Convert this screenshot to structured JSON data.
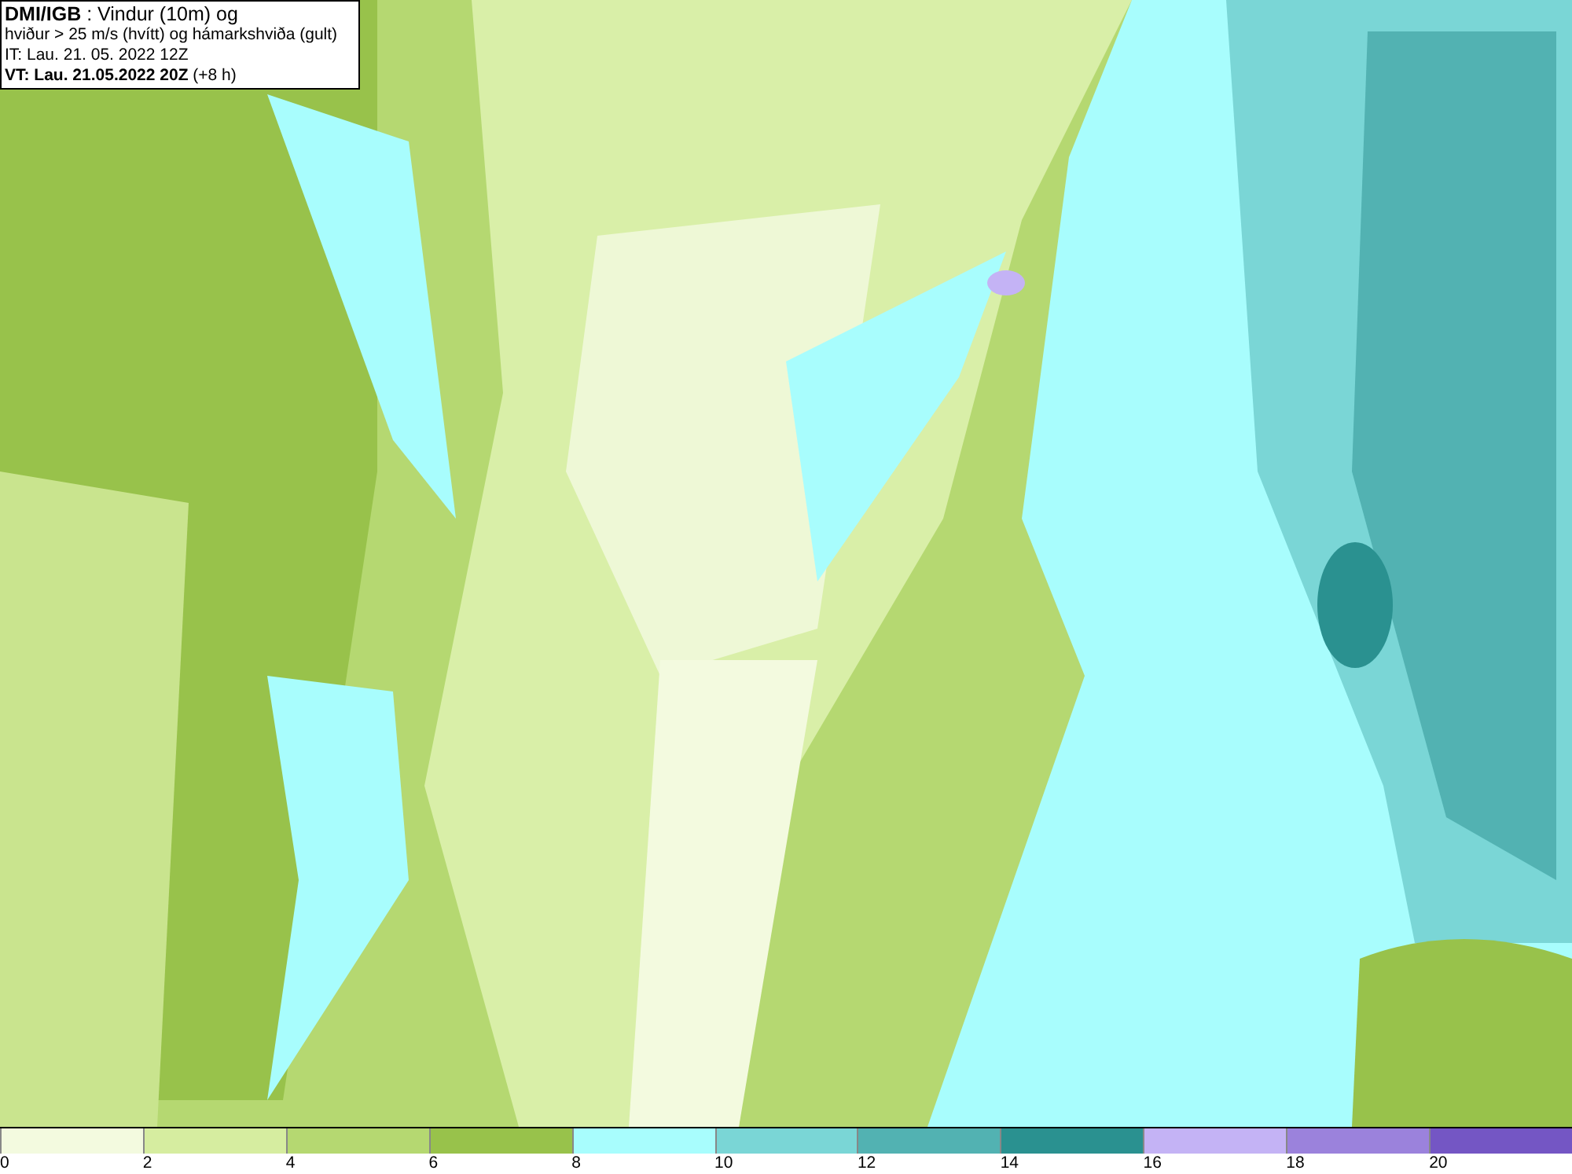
{
  "info_box": {
    "lines": [
      "**DMI/IGB** : Vindur (10m) og",
      "hviður > 25 m/s (hvítt) og hámarkshviða (gult)",
      "IT: Lau. 21. 05. 2022 12Z",
      "**VT: Lau. 21.05.2022 20Z** (+8 h)"
    ]
  },
  "legend": {
    "segments": [
      {
        "color": "#f3fadf",
        "label": "0"
      },
      {
        "color": "#d6eda0",
        "label": "2"
      },
      {
        "color": "#b5d871",
        "label": "4"
      },
      {
        "color": "#98c24b",
        "label": "6"
      },
      {
        "color": "#a8fdfd",
        "label": "8"
      },
      {
        "color": "#7ad6d6",
        "label": "10"
      },
      {
        "color": "#52b2b2",
        "label": "12"
      },
      {
        "color": "#2a9190",
        "label": "14"
      },
      {
        "color": "#c4b3f5",
        "label": "16"
      },
      {
        "color": "#9b82dc",
        "label": "18"
      },
      {
        "color": "#7456c4",
        "label": "20"
      }
    ]
  }
}
